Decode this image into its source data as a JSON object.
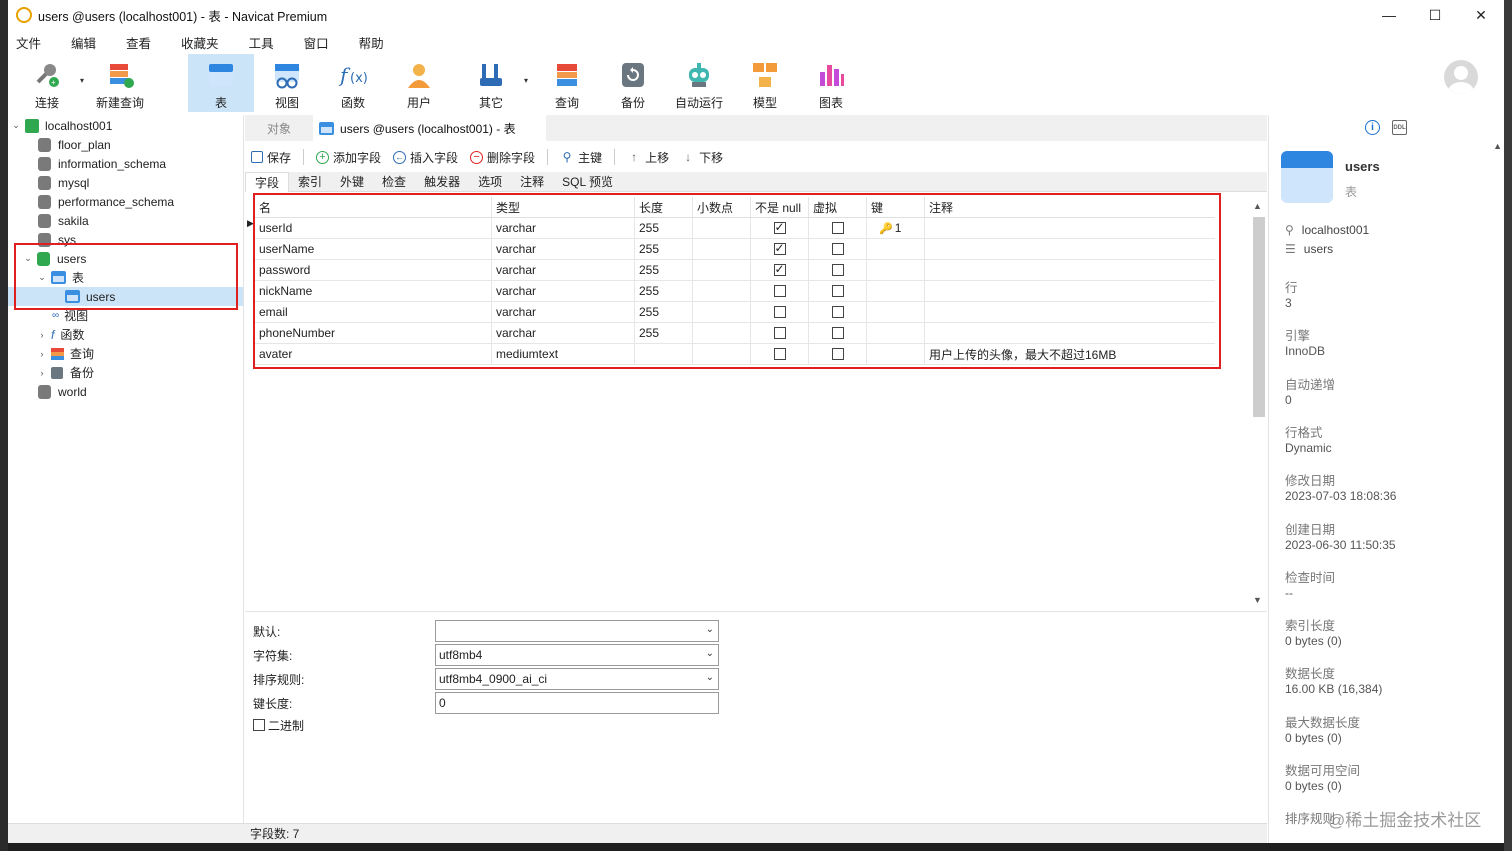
{
  "window": {
    "title": "users @users (localhost001) - 表 - Navicat Premium"
  },
  "menu": [
    "文件",
    "编辑",
    "查看",
    "收藏夹",
    "工具",
    "窗口",
    "帮助"
  ],
  "toolbar": [
    {
      "label": "连接",
      "icon": "connection-icon",
      "dropdown": true
    },
    {
      "label": "新建查询",
      "icon": "new-query-icon"
    },
    {
      "label": "表",
      "icon": "table-icon",
      "active": true
    },
    {
      "label": "视图",
      "icon": "view-icon"
    },
    {
      "label": "函数",
      "icon": "function-icon"
    },
    {
      "label": "用户",
      "icon": "user-icon"
    },
    {
      "label": "其它",
      "icon": "tools-icon",
      "dropdown": true
    },
    {
      "label": "查询",
      "icon": "query-icon"
    },
    {
      "label": "备份",
      "icon": "backup-icon"
    },
    {
      "label": "自动运行",
      "icon": "robot-icon"
    },
    {
      "label": "模型",
      "icon": "model-icon"
    },
    {
      "label": "图表",
      "icon": "chart-icon"
    }
  ],
  "nav": {
    "connection": "localhost001",
    "databases": [
      "floor_plan",
      "information_schema",
      "mysql",
      "performance_schema",
      "sakila",
      "sys"
    ],
    "open_db": "users",
    "tables_node": "表",
    "selected_table": "users",
    "other_nodes": [
      "视图",
      "函数",
      "查询",
      "备份"
    ],
    "last_db": "world"
  },
  "tabs": {
    "objects": "对象",
    "active": "users @users (localhost001) - 表"
  },
  "subtoolbar": [
    "保存",
    "添加字段",
    "插入字段",
    "删除字段",
    "主键",
    "上移",
    "下移"
  ],
  "field_tabs": [
    "字段",
    "索引",
    "外键",
    "检查",
    "触发器",
    "选项",
    "注释",
    "SQL 预览"
  ],
  "grid": {
    "columns": [
      "名",
      "类型",
      "长度",
      "小数点",
      "不是 null",
      "虚拟",
      "键",
      "注释"
    ],
    "rows": [
      {
        "name": "userId",
        "type": "varchar",
        "length": "255",
        "decimal": "",
        "notnull": true,
        "virtual": false,
        "key": "1",
        "comment": ""
      },
      {
        "name": "userName",
        "type": "varchar",
        "length": "255",
        "decimal": "",
        "notnull": true,
        "virtual": false,
        "key": "",
        "comment": ""
      },
      {
        "name": "password",
        "type": "varchar",
        "length": "255",
        "decimal": "",
        "notnull": true,
        "virtual": false,
        "key": "",
        "comment": ""
      },
      {
        "name": "nickName",
        "type": "varchar",
        "length": "255",
        "decimal": "",
        "notnull": false,
        "virtual": false,
        "key": "",
        "comment": ""
      },
      {
        "name": "email",
        "type": "varchar",
        "length": "255",
        "decimal": "",
        "notnull": false,
        "virtual": false,
        "key": "",
        "comment": ""
      },
      {
        "name": "phoneNumber",
        "type": "varchar",
        "length": "255",
        "decimal": "",
        "notnull": false,
        "virtual": false,
        "key": "",
        "comment": ""
      },
      {
        "name": "avater",
        "type": "mediumtext",
        "length": "",
        "decimal": "",
        "notnull": false,
        "virtual": false,
        "key": "",
        "comment": "用户上传的头像，最大不超过16MB"
      }
    ]
  },
  "props": {
    "default_label": "默认:",
    "default_value": "",
    "charset_label": "字符集:",
    "charset_value": "utf8mb4",
    "collation_label": "排序规则:",
    "collation_value": "utf8mb4_0900_ai_ci",
    "keylen_label": "键长度:",
    "keylen_value": "0",
    "binary_label": "二进制"
  },
  "status": {
    "field_count": "字段数: 7"
  },
  "info": {
    "name": "users",
    "subtitle": "表",
    "connection": "localhost001",
    "database": "users",
    "items": [
      {
        "label": "行",
        "value": "3"
      },
      {
        "label": "引擎",
        "value": "InnoDB"
      },
      {
        "label": "自动递增",
        "value": "0"
      },
      {
        "label": "行格式",
        "value": "Dynamic"
      },
      {
        "label": "修改日期",
        "value": "2023-07-03 18:08:36"
      },
      {
        "label": "创建日期",
        "value": "2023-06-30 11:50:35"
      },
      {
        "label": "检查时间",
        "value": "--"
      },
      {
        "label": "索引长度",
        "value": "0 bytes (0)"
      },
      {
        "label": "数据长度",
        "value": "16.00 KB (16,384)"
      },
      {
        "label": "最大数据长度",
        "value": "0 bytes (0)"
      },
      {
        "label": "数据可用空间",
        "value": "0 bytes (0)"
      },
      {
        "label": "排序规则",
        "value": ""
      }
    ]
  },
  "watermark": "@稀土掘金技术社区",
  "colors": {
    "accent": "#cce4f7",
    "highlight": "#e02020",
    "db_active": "#2fa84f"
  }
}
